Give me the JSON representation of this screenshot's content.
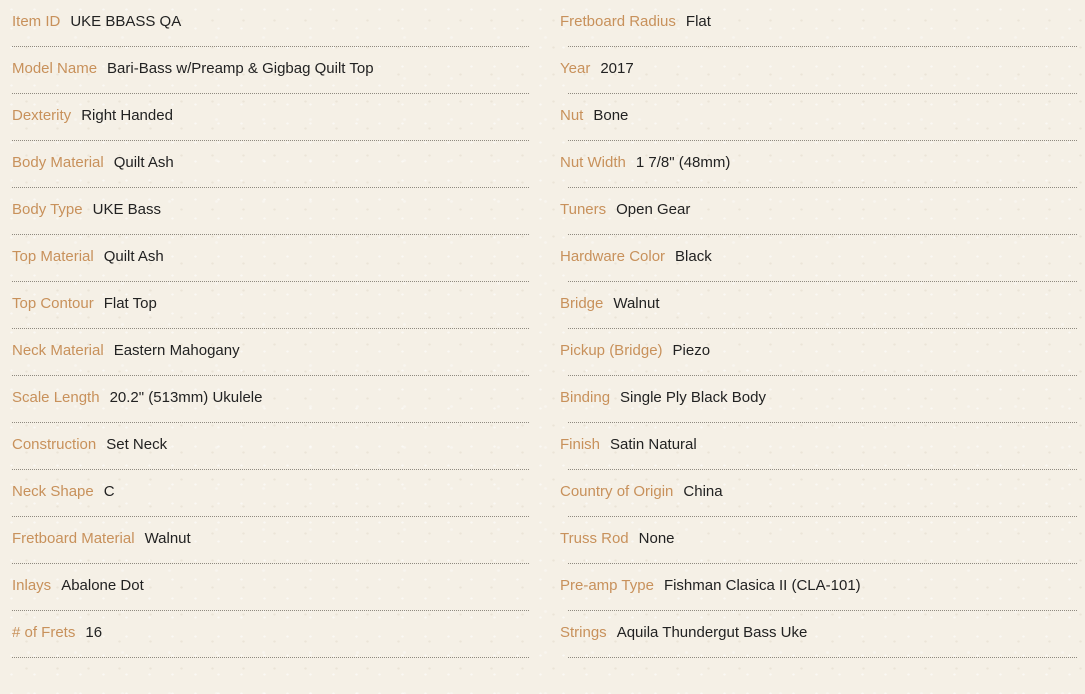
{
  "colors": {
    "label": "#c8915b",
    "value": "#222222",
    "background": "#f5f0e6"
  },
  "specs": {
    "left": [
      {
        "label": "Item ID",
        "value": "UKE BBASS QA"
      },
      {
        "label": "Model Name",
        "value": "Bari-Bass w/Preamp & Gigbag Quilt Top"
      },
      {
        "label": "Dexterity",
        "value": "Right Handed"
      },
      {
        "label": "Body Material",
        "value": "Quilt Ash"
      },
      {
        "label": "Body Type",
        "value": "UKE Bass"
      },
      {
        "label": "Top Material",
        "value": "Quilt Ash"
      },
      {
        "label": "Top Contour",
        "value": "Flat Top"
      },
      {
        "label": "Neck Material",
        "value": "Eastern Mahogany"
      },
      {
        "label": "Scale Length",
        "value": "20.2\" (513mm) Ukulele"
      },
      {
        "label": "Construction",
        "value": "Set Neck"
      },
      {
        "label": "Neck Shape",
        "value": "C"
      },
      {
        "label": "Fretboard Material",
        "value": "Walnut"
      },
      {
        "label": "Inlays",
        "value": "Abalone Dot"
      },
      {
        "label": "# of Frets",
        "value": "16"
      }
    ],
    "right": [
      {
        "label": "Fretboard Radius",
        "value": "Flat"
      },
      {
        "label": "Year",
        "value": "2017"
      },
      {
        "label": "Nut",
        "value": "Bone"
      },
      {
        "label": "Nut Width",
        "value": "1 7/8\" (48mm)"
      },
      {
        "label": "Tuners",
        "value": "Open Gear"
      },
      {
        "label": "Hardware Color",
        "value": "Black"
      },
      {
        "label": "Bridge",
        "value": "Walnut"
      },
      {
        "label": "Pickup (Bridge)",
        "value": "Piezo"
      },
      {
        "label": "Binding",
        "value": "Single Ply Black Body"
      },
      {
        "label": "Finish",
        "value": "Satin Natural"
      },
      {
        "label": "Country of Origin",
        "value": "China"
      },
      {
        "label": "Truss Rod",
        "value": "None"
      },
      {
        "label": "Pre-amp Type",
        "value": "Fishman Clasica II (CLA-101)"
      },
      {
        "label": "Strings",
        "value": "Aquila Thundergut Bass Uke"
      }
    ]
  }
}
